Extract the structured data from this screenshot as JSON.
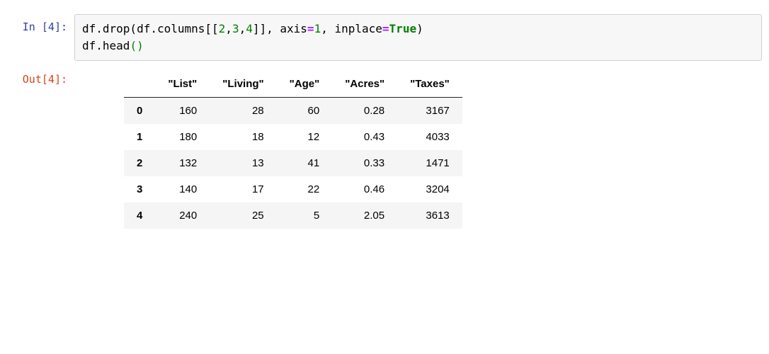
{
  "input": {
    "prompt_prefix": "In [",
    "prompt_num": "4",
    "prompt_suffix": "]:",
    "code_line1_parts": {
      "p1": "df.drop(df.columns[[",
      "n1": "2",
      "c1": ",",
      "n2": "3",
      "c2": ",",
      "n3": "4",
      "p2": "]], axis",
      "eq1": "=",
      "n4": "1",
      "c3": ", inplace",
      "eq2": "=",
      "kw": "True",
      "p3": ")"
    },
    "code_line2_parts": {
      "p1": "df.head",
      "open": "(",
      "close": ")"
    }
  },
  "output": {
    "prompt_prefix": "Out[",
    "prompt_num": "4",
    "prompt_suffix": "]:",
    "table": {
      "columns": [
        "\"List\"",
        "\"Living\"",
        "\"Age\"",
        "\"Acres\"",
        "\"Taxes\""
      ],
      "index": [
        "0",
        "1",
        "2",
        "3",
        "4"
      ],
      "rows": [
        [
          "160",
          "28",
          "60",
          "0.28",
          "3167"
        ],
        [
          "180",
          "18",
          "12",
          "0.43",
          "4033"
        ],
        [
          "132",
          "13",
          "41",
          "0.33",
          "1471"
        ],
        [
          "140",
          "17",
          "22",
          "0.46",
          "3204"
        ],
        [
          "240",
          "25",
          "5",
          "2.05",
          "3613"
        ]
      ]
    }
  }
}
